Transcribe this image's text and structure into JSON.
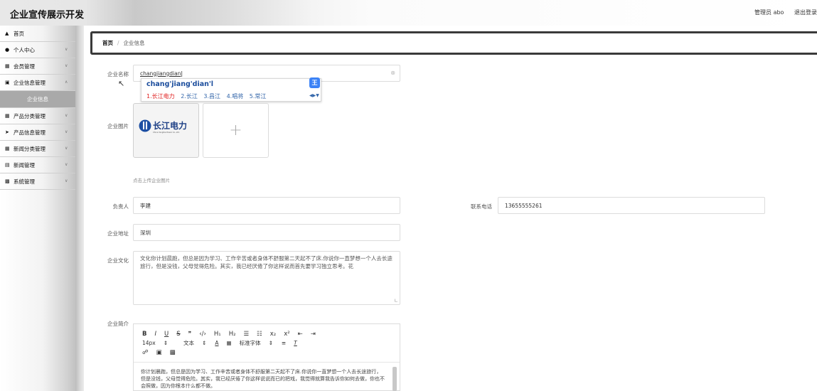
{
  "header": {
    "app_title": "企业宣传展示开发",
    "admin_label": "管理员 abo",
    "logout_label": "退出登录"
  },
  "sidebar": {
    "items": [
      {
        "label": "首页",
        "icon": "home-icon"
      },
      {
        "label": "个人中心",
        "icon": "user-icon"
      },
      {
        "label": "会员管理",
        "icon": "grid-icon"
      },
      {
        "label": "企业信息管理",
        "icon": "building-icon"
      },
      {
        "label": "企业信息",
        "sub": true
      },
      {
        "label": "产品分类管理",
        "icon": "grid-icon"
      },
      {
        "label": "产品信息管理",
        "icon": "send-icon"
      },
      {
        "label": "新闻分类管理",
        "icon": "grid-icon"
      },
      {
        "label": "新闻管理",
        "icon": "doc-icon"
      },
      {
        "label": "系统管理",
        "icon": "monitor-icon"
      }
    ]
  },
  "breadcrumb": {
    "home": "首页",
    "separator": "/",
    "current": "企业信息"
  },
  "form": {
    "company_name_label": "企业名称",
    "company_name_value": "changjiangdian",
    "company_image_label": "企业图片",
    "upload_hint": "点击上传企业图片",
    "logo_text": "长江电力",
    "logo_subtext": "China Yangtze Power Co.,Ltd.",
    "manager_label": "负责人",
    "manager_value": "李建",
    "phone_label": "联系电话",
    "phone_value": "13655555261",
    "address_label": "企业地址",
    "address_value": "深圳",
    "culture_label": "企业文化",
    "culture_value": "文化你计划晨跑，但总是因为学习、工作辛苦或者身体不舒服第二天起不了床.你说你一直梦想一个人去长途旅行，但是没钱，父母觉得危险。其实，我已经厌倦了你这样说而首先要学习独立思考。花",
    "intro_label": "企业简介"
  },
  "ime": {
    "pinyin": "chang'jiang'dian'l",
    "candidates": [
      "1.长江电力",
      "2.长江",
      "3.昌江",
      "4.唱将",
      "5.常江"
    ],
    "logo_char": "王"
  },
  "editor": {
    "toolbar_row1": [
      "B",
      "I",
      "U",
      "S",
      "❞",
      "‹/›",
      "H₁",
      "H₂",
      "☰",
      "☷",
      "x₂",
      "x²",
      "⇤",
      "⇥"
    ],
    "size_value": "14px",
    "type_value": "文本",
    "font_value": "标准字体",
    "body": "你计划晨跑，但总是因为学习、工作辛苦或者身体不舒服第二天起不了床.你说你一直梦想一个人去长途旅行，但是没钱，父母觉得危险。其实，我已经厌倦了你这样说说而已的把戏，我觉得就算我告诉你如何去做，你也不会照做，因为你根本什么都不做。"
  },
  "colors": {
    "ime_pinyin": "#1a4c9c",
    "ime_first": "#e02020",
    "ime_logo": "#3b82f6",
    "sidebar_active": "#a9a9a9"
  }
}
